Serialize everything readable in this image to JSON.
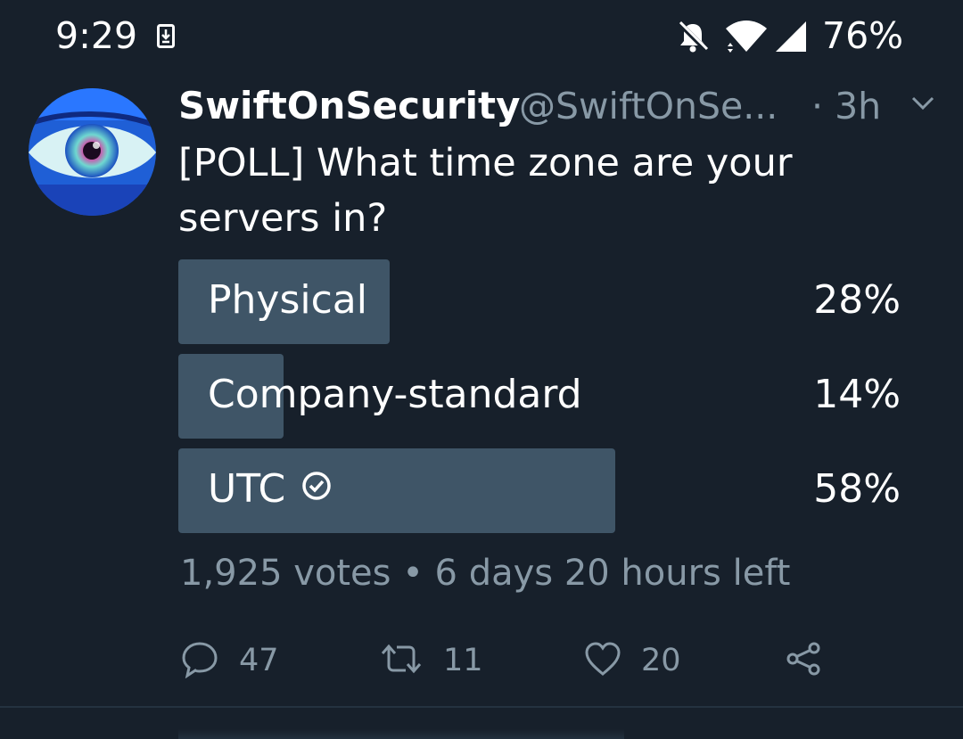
{
  "status_bar": {
    "time": "9:29",
    "battery": "76%",
    "icons": [
      "download-icon",
      "bell-muted-icon",
      "wifi-icon",
      "cell-signal-icon"
    ]
  },
  "tweet": {
    "author_name": "SwiftOnSecurity",
    "handle": "@SwiftOnSe...",
    "time": "· 3h",
    "text_line1": "[POLL] What time zone are your",
    "text_line2": "servers in?",
    "avatar": "eye-avatar"
  },
  "poll": {
    "options": [
      {
        "label": "Physical",
        "percent": "28%",
        "value": 28
      },
      {
        "label": "Company-standard",
        "percent": "14%",
        "value": 14
      },
      {
        "label": "UTC",
        "percent": "58%",
        "value": 58,
        "selected": true
      }
    ],
    "meta": "1,925 votes • 6 days 20 hours left"
  },
  "actions": {
    "reply_count": "47",
    "retweet_count": "11",
    "like_count": "20"
  },
  "colors": {
    "background": "#17202b",
    "poll_bar": "#3f5567",
    "secondary_text": "#8899a6"
  }
}
